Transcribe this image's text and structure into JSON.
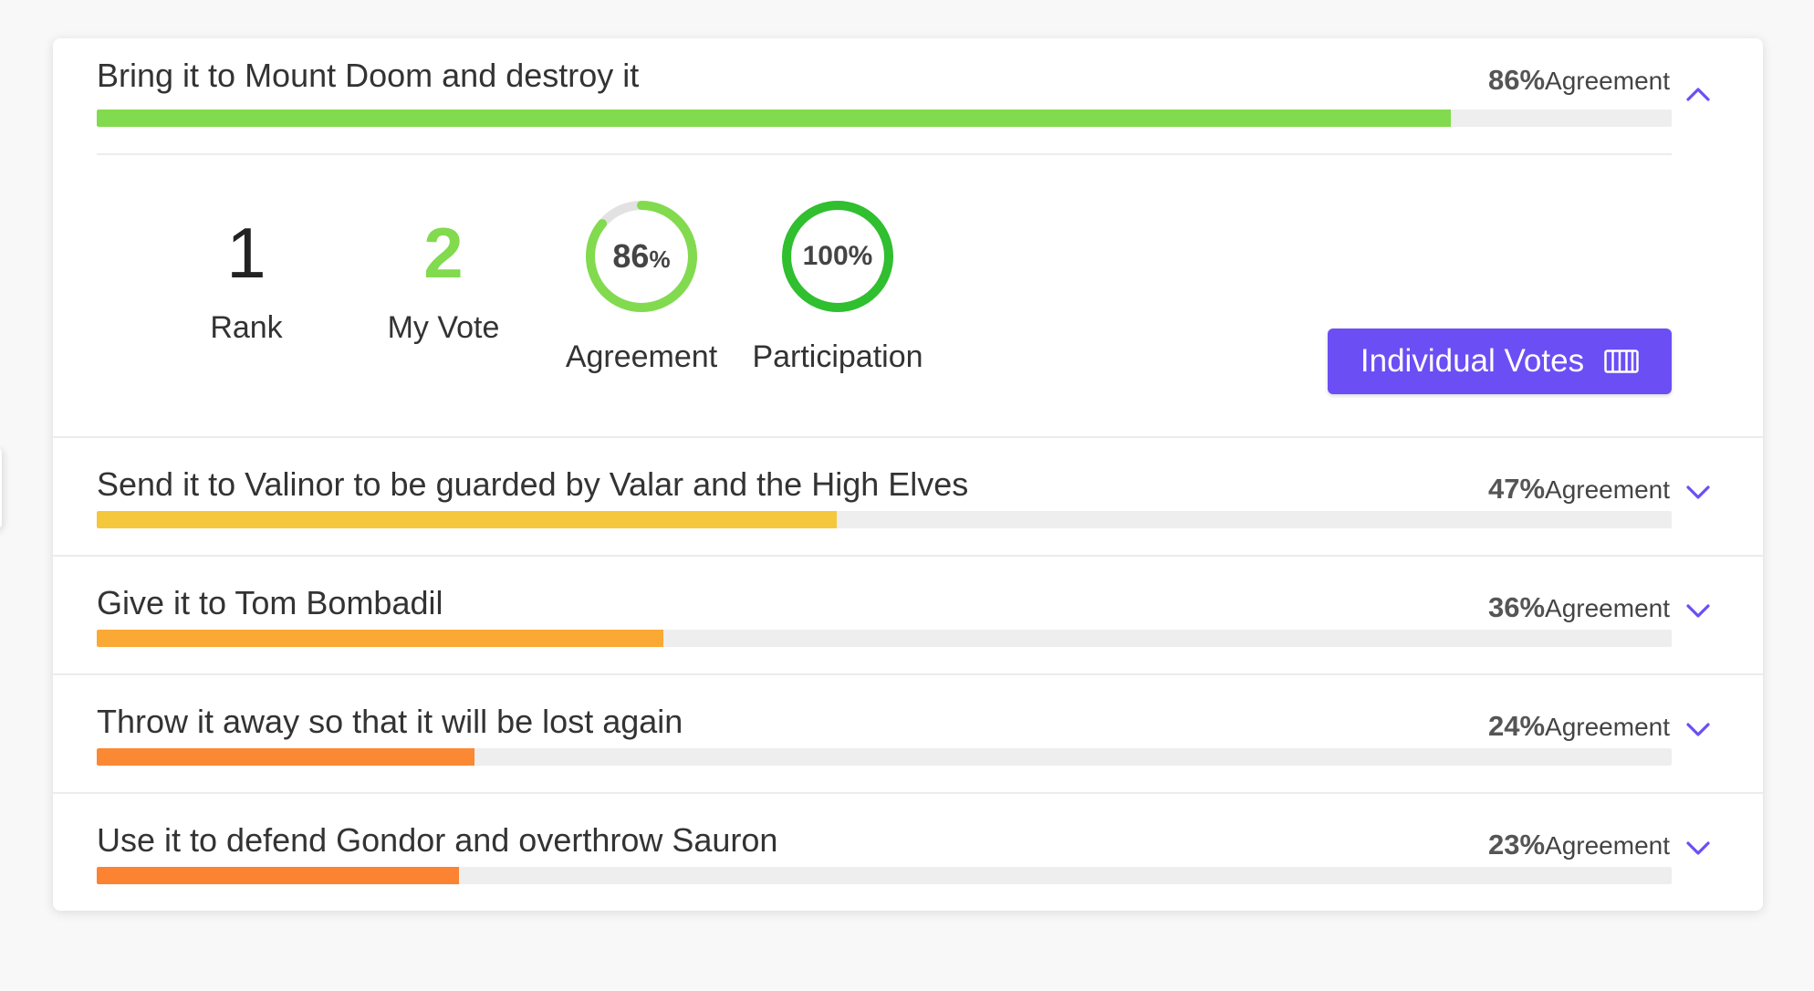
{
  "proposals": [
    {
      "title": "Bring it to Mount Doom and destroy it",
      "agreement_value": "86%",
      "agreement_label": "Agreement",
      "agreement": 86,
      "bar_color": "#82da4e",
      "expanded": true
    },
    {
      "title": "Send it to Valinor to be guarded by Valar and the High Elves",
      "agreement_value": "47%",
      "agreement_label": "Agreement",
      "agreement": 47,
      "bar_color": "#f5c73d",
      "expanded": false
    },
    {
      "title": "Give it to Tom Bombadil",
      "agreement_value": "36%",
      "agreement_label": "Agreement",
      "agreement": 36,
      "bar_color": "#fba935",
      "expanded": false
    },
    {
      "title": "Throw it away so that it will be lost again",
      "agreement_value": "24%",
      "agreement_label": "Agreement",
      "agreement": 24,
      "bar_color": "#fb8832",
      "expanded": false
    },
    {
      "title": "Use it to defend Gondor and overthrow Sauron",
      "agreement_value": "23%",
      "agreement_label": "Agreement",
      "agreement": 23,
      "bar_color": "#fb8332",
      "expanded": false
    }
  ],
  "details": {
    "rank_value": "1",
    "rank_label": "Rank",
    "my_vote_value": "2",
    "my_vote_label": "My Vote",
    "agreement_ring_number": "86",
    "agreement_ring_unit": "%",
    "agreement_ring_percent": 86,
    "agreement_label": "Agreement",
    "participation_ring_text": "100%",
    "participation_percent": 100,
    "participation_label": "Participation",
    "individual_votes_label": "Individual Votes",
    "individual_votes_icon": "columns-icon"
  },
  "colors": {
    "accent": "#6c4ef5",
    "my_vote": "#82da4e",
    "agreement_ring": "#82da4e",
    "participation_ring": "#2fbf2f",
    "ring_track": "#e2e2e2"
  }
}
